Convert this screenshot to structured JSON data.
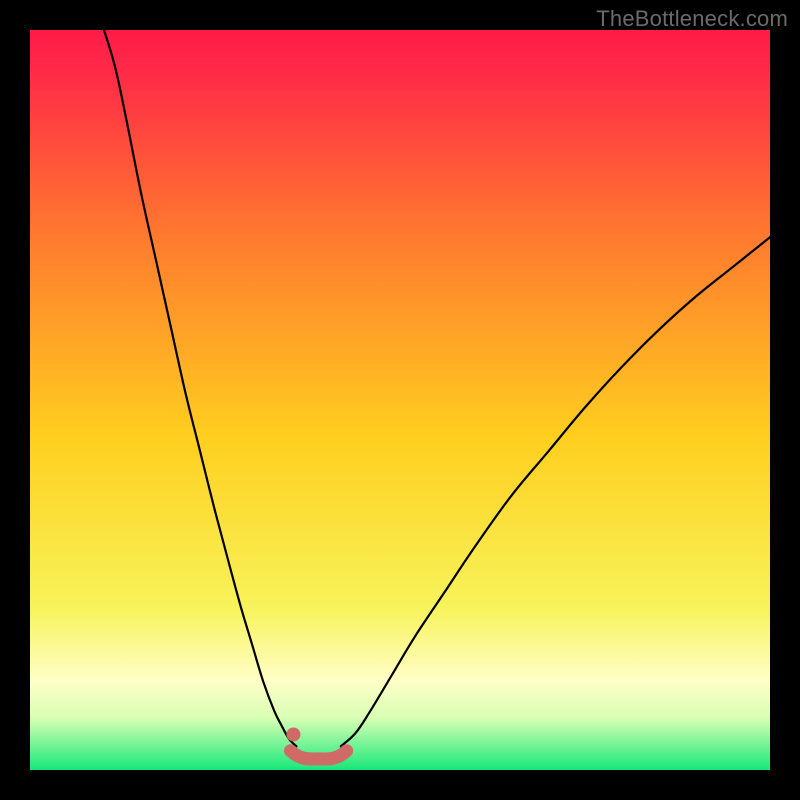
{
  "watermark": "TheBottleneck.com",
  "colors": {
    "frame": "#000000",
    "gradient_top": "#ff1c47",
    "gradient_mid": "#ffd21f",
    "gradient_bottom": "#17e879",
    "curve": "#000000",
    "floor_marker": "#cf6a66"
  },
  "chart_data": {
    "type": "line",
    "title": "",
    "xlabel": "",
    "ylabel": "",
    "xlim": [
      0,
      100
    ],
    "ylim": [
      0,
      100
    ],
    "grid": false,
    "legend": false,
    "annotations": [],
    "series": [
      {
        "name": "left-branch",
        "x": [
          10,
          11.5,
          13,
          15,
          17,
          19,
          21,
          23,
          25,
          27,
          28.5,
          30,
          31.5,
          33,
          34,
          35,
          36
        ],
        "y": [
          100,
          95,
          88,
          78,
          69,
          60,
          51,
          43,
          35,
          27.5,
          22,
          17,
          12,
          8,
          6,
          4.2,
          3.2
        ]
      },
      {
        "name": "right-branch",
        "x": [
          42,
          44,
          46,
          49,
          52,
          56,
          60,
          65,
          70,
          75,
          80,
          85,
          90,
          95,
          100
        ],
        "y": [
          3.2,
          5,
          8,
          13,
          18,
          24,
          30,
          37,
          43,
          49,
          54.5,
          59.5,
          64,
          68,
          72
        ]
      },
      {
        "name": "floor-marker",
        "x": [
          35.2,
          36,
          37,
          38,
          39,
          40,
          41,
          42,
          42.8
        ],
        "y": [
          2.6,
          2.0,
          1.6,
          1.5,
          1.5,
          1.5,
          1.6,
          2.0,
          2.6
        ]
      }
    ],
    "marker_dot": {
      "x": 35.6,
      "y": 4.8
    }
  }
}
